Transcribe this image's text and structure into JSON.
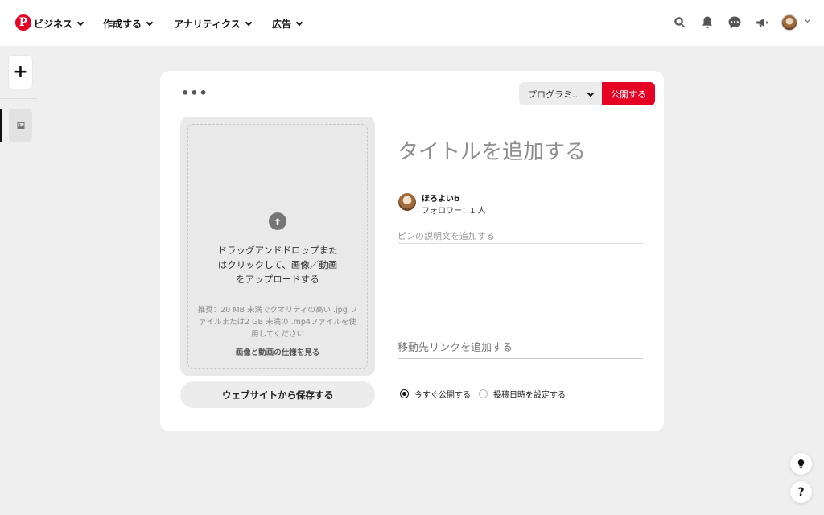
{
  "header": {
    "nav": [
      {
        "label": "ビジネス"
      },
      {
        "label": "作成する"
      },
      {
        "label": "アナリティクス"
      },
      {
        "label": "広告"
      }
    ],
    "icons": [
      "search-icon",
      "bell-icon",
      "chat-icon",
      "megaphone-icon",
      "avatar",
      "chevron-down-icon"
    ]
  },
  "rail": {
    "add_label": "+"
  },
  "editor": {
    "more_label": "•••",
    "board_select": "プログラミ...",
    "publish_label": "公開する",
    "upload": {
      "instruction": "ドラッグアンドドロップまたはクリックして、画像／動画をアップロードする",
      "recommendation": "推奨：20 MB 未満でクオリティの高い .jpg ファイルまたは2 GB 未満の .mp4ファイルを使用してください",
      "spec_link": "画像と動画の仕様を見る"
    },
    "save_from_web": "ウェブサイトから保存する",
    "title_placeholder": "タイトルを追加する",
    "user": {
      "name": "ほろよいb",
      "followers": "フォロワー：1 人"
    },
    "description_placeholder": "ピンの説明文を追加する",
    "link_placeholder": "移動先リンクを追加する",
    "publish_options": [
      {
        "label": "今すぐ公開する",
        "selected": true
      },
      {
        "label": "投稿日時を設定する",
        "selected": false
      }
    ]
  },
  "floating": {
    "help_label": "?"
  },
  "colors": {
    "brand": "#e60023",
    "background": "#efefef"
  }
}
